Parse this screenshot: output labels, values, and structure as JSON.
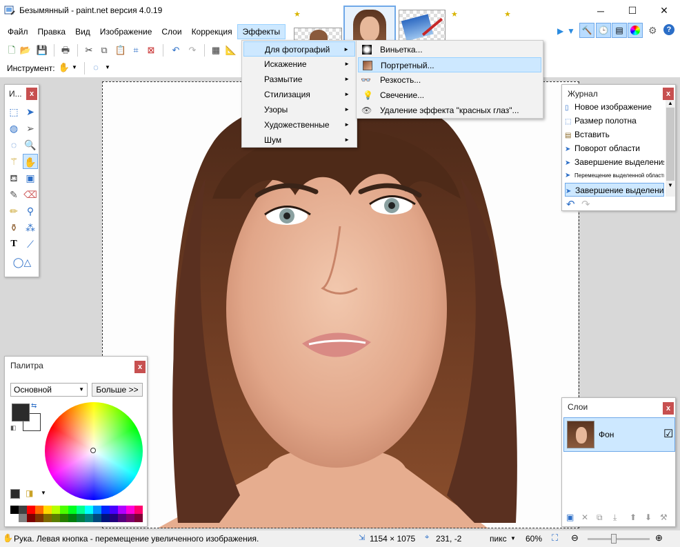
{
  "window": {
    "title": "Безымянный - paint.net версия 4.0.19",
    "minimize": "─",
    "maximize": "☐",
    "close": "✕"
  },
  "menu": [
    "Файл",
    "Правка",
    "Вид",
    "Изображение",
    "Слои",
    "Коррекция",
    "Эффекты"
  ],
  "toolbar2": {
    "tool_label": "Инструмент:"
  },
  "tools_window": {
    "title": "И...",
    "close": "x"
  },
  "effects_menu": {
    "items": [
      {
        "label": "Для фотографий",
        "submenu": true
      },
      {
        "label": "Искажение",
        "submenu": true
      },
      {
        "label": "Размытие",
        "submenu": true
      },
      {
        "label": "Стилизация",
        "submenu": true
      },
      {
        "label": "Узоры",
        "submenu": true
      },
      {
        "label": "Художественные",
        "submenu": true
      },
      {
        "label": "Шум",
        "submenu": true
      }
    ],
    "submenu_arrow": "►"
  },
  "photo_submenu": {
    "items": [
      {
        "label": "Виньетка...",
        "icon": "vignette-icon"
      },
      {
        "label": "Портретный...",
        "icon": "portrait-icon"
      },
      {
        "label": "Резкость...",
        "icon": "glasses-icon"
      },
      {
        "label": "Свечение...",
        "icon": "bulb-icon"
      },
      {
        "label": "Удаление эффекта \"красных глаз\"...",
        "icon": "eye-icon"
      }
    ]
  },
  "history": {
    "title": "Журнал",
    "close": "x",
    "items": [
      "Новое изображение",
      "Размер полотна",
      "Вставить",
      "Поворот области",
      "Завершение выделения",
      "Перемещение выделенной области",
      "Завершение выделения"
    ]
  },
  "palette": {
    "title": "Палитра",
    "close": "x",
    "mode": "Основной",
    "more_button": "Больше >>",
    "primary_color": "#2b2b2b",
    "secondary_color": "#ffffff"
  },
  "layers": {
    "title": "Слои",
    "close": "x",
    "layer_name": "Фон",
    "checkbox": "☑"
  },
  "status": {
    "hint": "Рука. Левая кнопка - перемещение увеличенного изображения.",
    "size": "1154 × 1075",
    "cursor": "231, -2",
    "units": "пикс",
    "zoom": "60%"
  }
}
